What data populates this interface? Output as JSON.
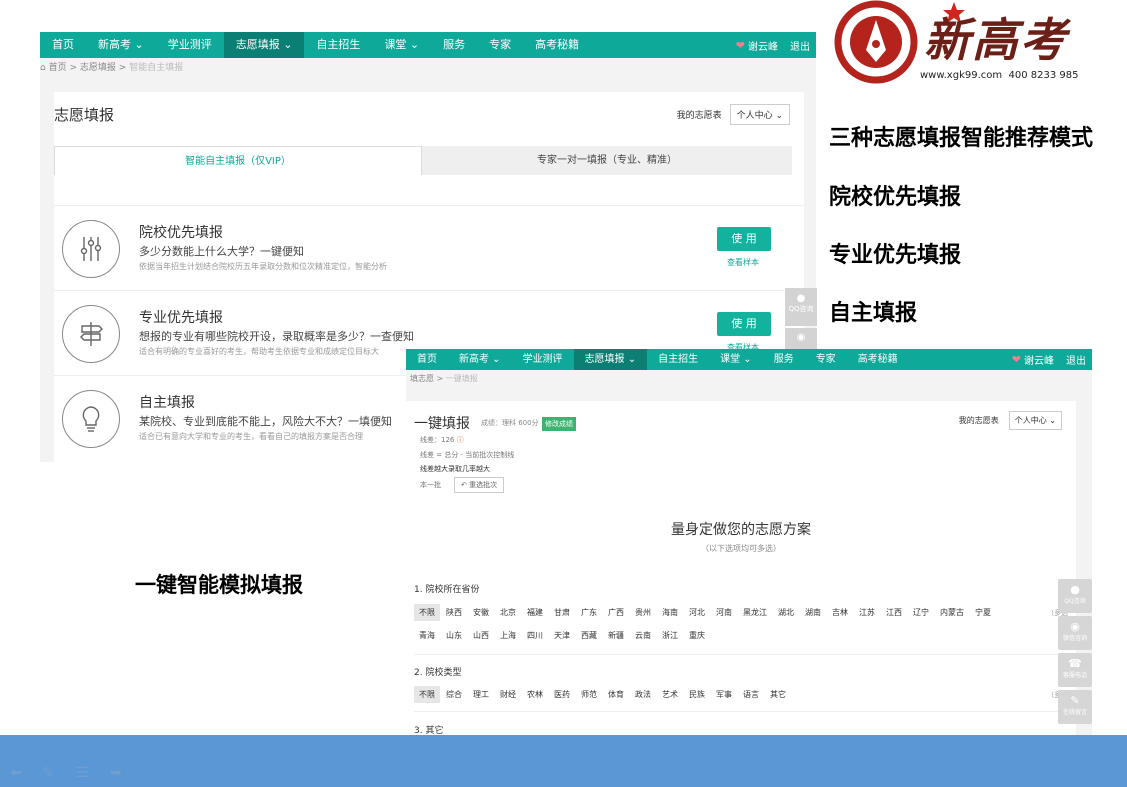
{
  "screen1": {
    "nav": [
      "首页",
      "新高考 ⌄",
      "学业测评",
      "志愿填报 ⌄",
      "自主招生",
      "课堂 ⌄",
      "服务",
      "专家",
      "高考秘籍"
    ],
    "active_nav": 3,
    "user": "谢云峰",
    "logout": "退出",
    "breadcrumb": {
      "home": "首页",
      "sep": ">",
      "mid": "志愿填报",
      "last": "智能自主填报"
    },
    "title": "志愿填报",
    "my_plan": "我的志愿表",
    "center_select": "个人中心 ⌄",
    "tab_left": "智能自主填报（仅VIP）",
    "tab_right": "专家一对一填报（专业、精准）",
    "rows": [
      {
        "title": "院校优先填报",
        "sub": "多少分数能上什么大学？一键便知",
        "desc": "依据当年招生计划结合院校历五年录取分数和位次精准定位，智能分析",
        "use": "使 用",
        "sample": "查看样本"
      },
      {
        "title": "专业优先填报",
        "sub": "想报的专业有哪些院校开设，录取概率是多少？一查便知",
        "desc": "适合有明确的专业喜好的考生，帮助考生依据专业和成绩定位目标大",
        "use": "使 用",
        "sample": "查看样本"
      },
      {
        "title": "自主填报",
        "sub": "某院校、专业到底能不能上，风险大不大？一填便知",
        "desc": "适合已有意向大学和专业的考生，看看自己的填报方案是否合理"
      }
    ],
    "float_qq": "QQ咨询"
  },
  "screen2": {
    "nav": [
      "首页",
      "新高考 ⌄",
      "学业测评",
      "志愿填报 ⌄",
      "自主招生",
      "课堂 ⌄",
      "服务",
      "专家",
      "高考秘籍"
    ],
    "active_nav": 3,
    "user": "谢云峰",
    "logout": "退出",
    "breadcrumb": {
      "home": "填志愿",
      "sep": ">",
      "last": "一键填报"
    },
    "title": "一键填报",
    "score": "成绩：理科  600分",
    "modify": "修改成绩",
    "my_plan": "我的志愿表",
    "center_select": "个人中心 ⌄",
    "line_diff": "线差：126",
    "line_def": "线差 = 总分 - 当前批次控制线",
    "line_hint": "线差越大录取几率越大",
    "batch": "本一批",
    "redo": "重选批次",
    "heading": "量身定做您的志愿方案",
    "subheading": "（以下选项均可多选）",
    "sec1": "1. 院校所在省份",
    "provinces_row1": [
      "不限",
      "陕西",
      "安徽",
      "北京",
      "福建",
      "甘肃",
      "广东",
      "广西",
      "贵州",
      "海南",
      "河北",
      "河南",
      "黑龙江",
      "湖北",
      "湖南",
      "吉林",
      "江苏",
      "江西",
      "辽宁",
      "内蒙古",
      "宁夏"
    ],
    "provinces_row2": [
      "青海",
      "山东",
      "山西",
      "上海",
      "四川",
      "天津",
      "西藏",
      "新疆",
      "云南",
      "浙江",
      "重庆"
    ],
    "more": "（多选",
    "sec2": "2. 院校类型",
    "types": [
      "不限",
      "综合",
      "理工",
      "财经",
      "农林",
      "医药",
      "师范",
      "体育",
      "政法",
      "艺术",
      "民族",
      "军事",
      "语言",
      "其它"
    ],
    "sec3": "3. 其它",
    "side": [
      "QQ咨询",
      "微信咨询",
      "客服电话",
      "在线留言"
    ]
  },
  "right_text": [
    "三种志愿填报智能推荐模式",
    "院校优先填报",
    "专业优先填报",
    "自主填报"
  ],
  "left_caption": "一键智能模拟填报",
  "logo": {
    "brand": "新高考",
    "site": "www.xgk99.com",
    "phone": "400 8233 985"
  }
}
